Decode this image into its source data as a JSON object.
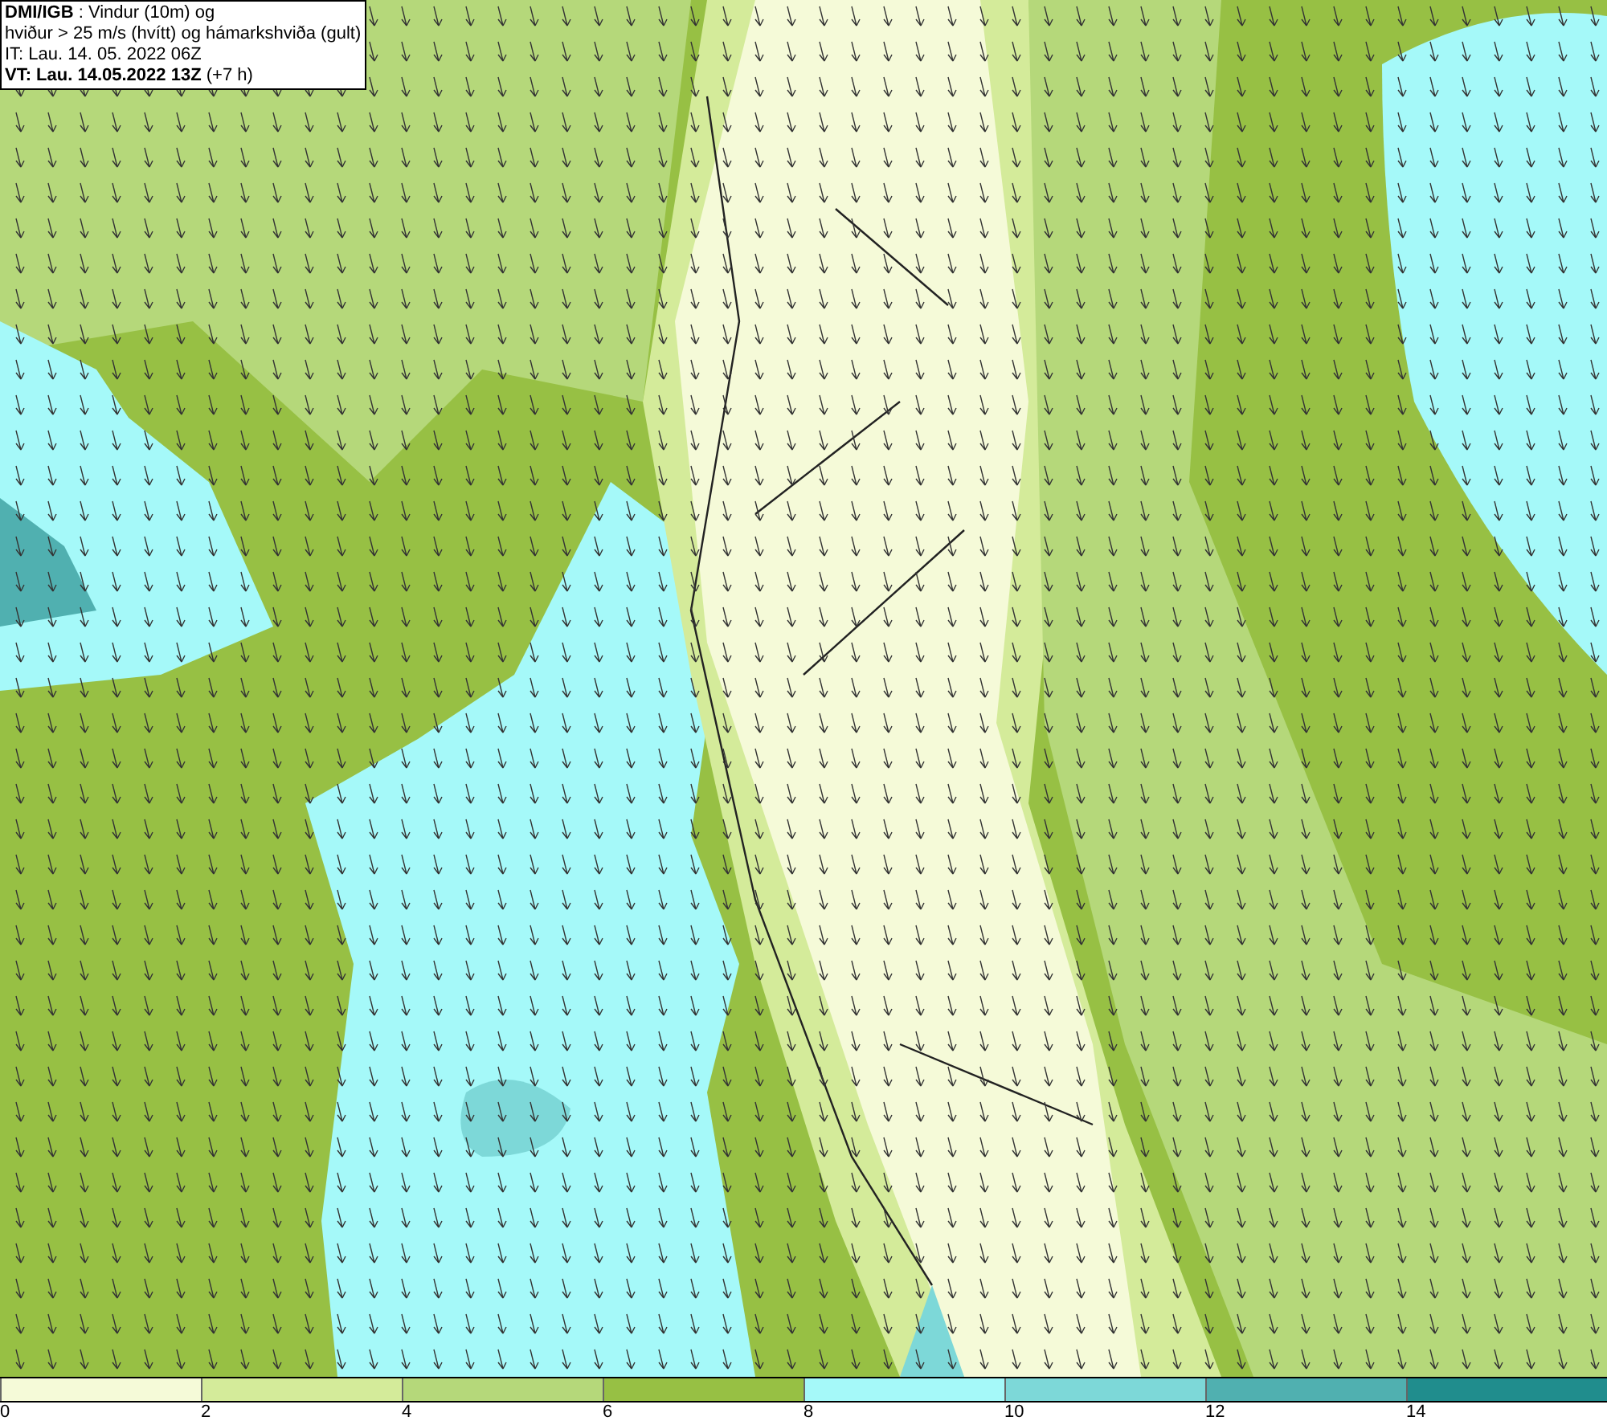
{
  "header": {
    "lines": [
      "**DMI/IGB** : Vindur (10m) og",
      "hviður > 25 m/s (hvítt) og hámarkshviða (gult)",
      "IT: Lau. 14. 05. 2022 06Z",
      "**VT: Lau. 14.05.2022 13Z** (+7 h)"
    ]
  },
  "legend": {
    "segments": [
      {
        "label": "0",
        "color": "#f5fad8"
      },
      {
        "label": "2",
        "color": "#d4eb9a"
      },
      {
        "label": "4",
        "color": "#b5d87a"
      },
      {
        "label": "6",
        "color": "#97c044"
      },
      {
        "label": "8",
        "color": "#a5f9f9"
      },
      {
        "label": "10",
        "color": "#7dd8d8"
      },
      {
        "label": "12",
        "color": "#50b0b0"
      },
      {
        "label": "14",
        "color": "#208d8d"
      }
    ]
  }
}
